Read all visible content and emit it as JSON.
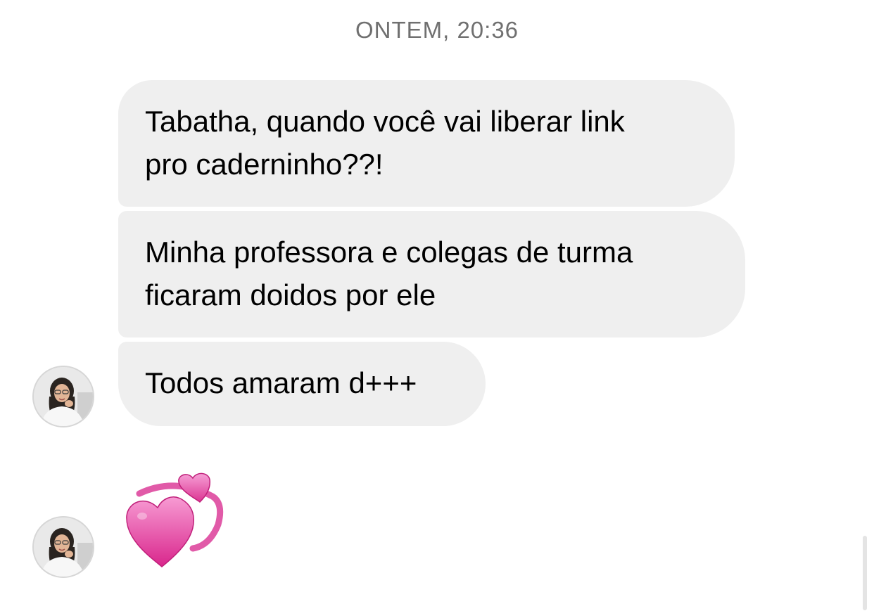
{
  "conversation": {
    "timestamp": "ONTEM, 20:36",
    "messages": [
      {
        "sender": "other",
        "lines": [
          "Tabatha, quando você vai liberar link",
          "pro caderninho??!"
        ]
      },
      {
        "sender": "other",
        "lines": [
          "Minha professora e colegas de turma",
          "ficaram doidos por ele"
        ]
      },
      {
        "sender": "other",
        "lines": [
          "Todos amaram d+++"
        ]
      }
    ],
    "reaction": {
      "icon": "revolving-hearts-icon",
      "color": "#e0409a"
    }
  },
  "colors": {
    "bubble_background": "#efefef",
    "timestamp_text": "#707070",
    "page_background": "#ffffff"
  }
}
